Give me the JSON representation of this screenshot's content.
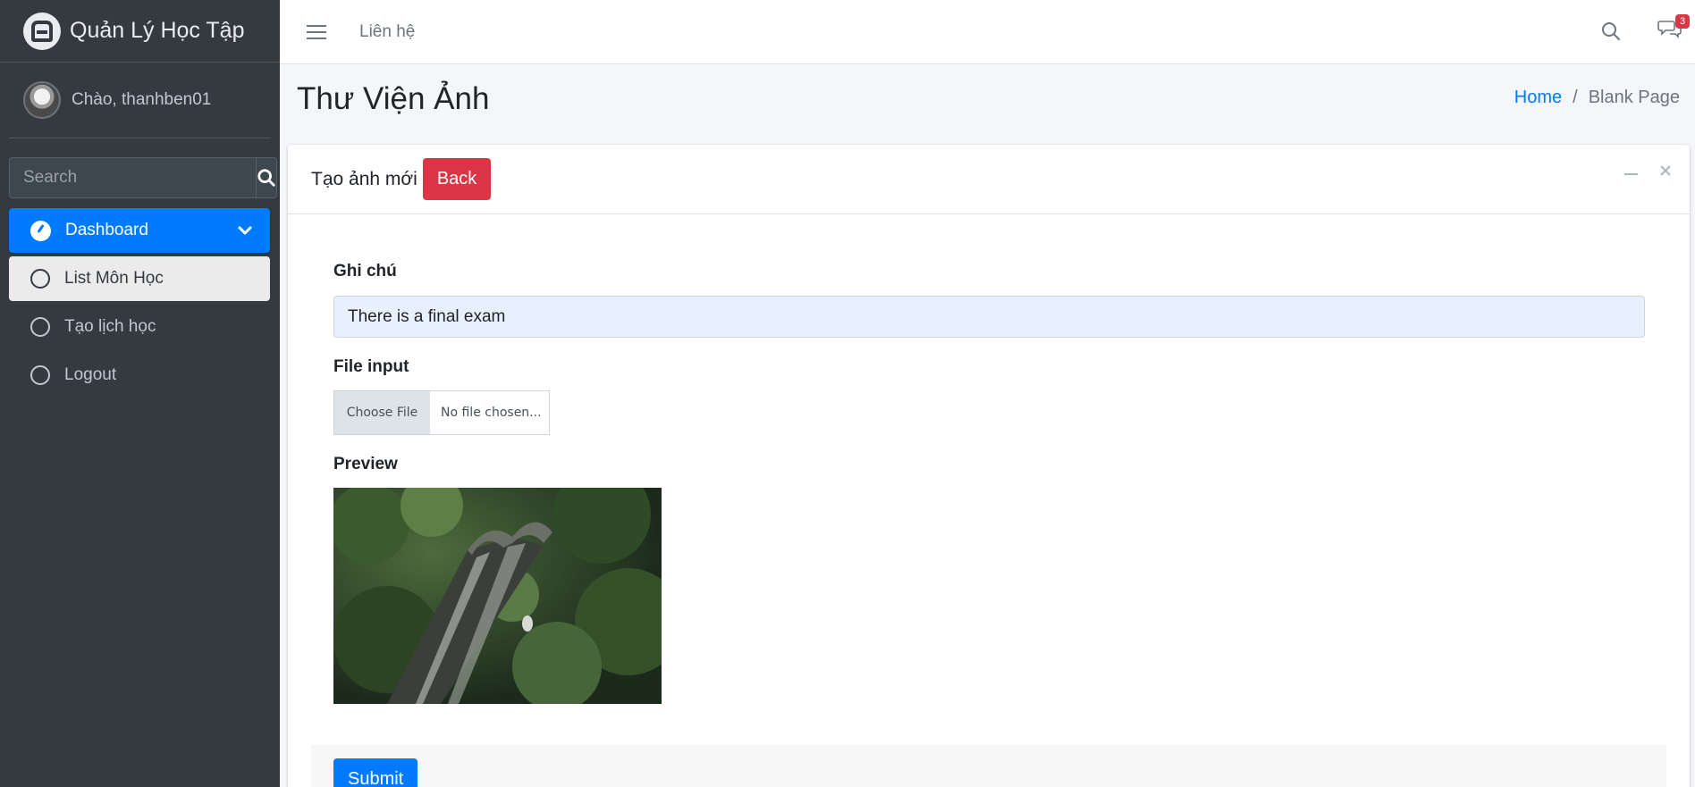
{
  "brand": {
    "name": "Quản Lý Học Tập",
    "icon": "app-logo-icon"
  },
  "user": {
    "greeting": "Chào, thanhben01"
  },
  "sidebar": {
    "search_placeholder": "Search",
    "items": [
      {
        "label": "Dashboard",
        "icon": "dashboard-gauge-icon"
      },
      {
        "label": "List Môn Học",
        "icon": "circle-icon"
      },
      {
        "label": "Tạo lịch học",
        "icon": "circle-icon"
      },
      {
        "label": "Logout",
        "icon": "circle-icon"
      }
    ]
  },
  "topbar": {
    "menu_link": "Liên hệ",
    "notification_count": "3"
  },
  "page": {
    "title": "Thư Viện Ảnh",
    "breadcrumb": {
      "home": "Home",
      "separator": "/",
      "current": "Blank Page"
    }
  },
  "card": {
    "title": "Tạo ảnh mới",
    "back_label": "Back",
    "note_label": "Ghi chú",
    "note_value": "There is a final exam",
    "file_label": "File input",
    "file_button": "Choose File",
    "file_status": "No file chosen...",
    "preview_label": "Preview",
    "submit_label": "Submit"
  },
  "colors": {
    "sidebar_bg": "#343a40",
    "primary": "#007bff",
    "danger": "#dc3545",
    "content_bg": "#f4f6f9"
  }
}
